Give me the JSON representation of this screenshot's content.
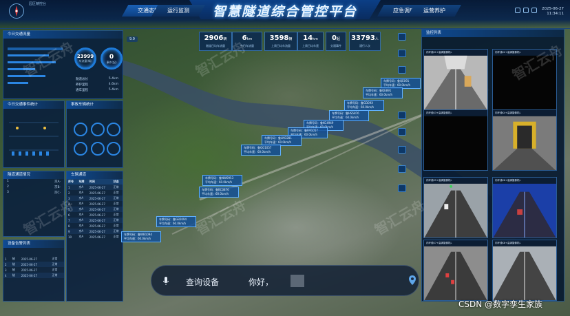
{
  "header": {
    "title": "智慧隧道综合管控平台",
    "brand_small": "园区精控台",
    "nav_left": [
      "交通态势",
      "运行监测"
    ],
    "nav_right": [
      "应急调度",
      "运营养护"
    ],
    "date": "2025-06-27",
    "time": "11:34:11"
  },
  "left_panels": {
    "traffic_stats": {
      "title": "今日交通流量",
      "gauge1_value": "23999",
      "gauge1_label": "车流量(辆)",
      "gauge2_value": "0",
      "gauge2_label": "事件(起)",
      "rows": [
        [
          "隧道总长",
          "5.4km"
        ],
        [
          "养护里程",
          "4.6km"
        ],
        [
          "通车里程",
          "5.4km"
        ]
      ]
    },
    "event_stats": {
      "title": "今日交通事件统计",
      "title2": "事故车辆统计"
    },
    "device_status": {
      "title": "隧道通道情况",
      "title2": "车辆通道",
      "rows": [
        [
          "1",
          "京A·"
        ],
        [
          "2",
          "京B·"
        ],
        [
          "3",
          "京C·"
        ]
      ]
    },
    "device_table": {
      "headers": [
        "序号",
        "车牌",
        "时间",
        "状态"
      ],
      "rows": [
        [
          "1",
          "京A",
          "2025-06-27",
          "正常"
        ],
        [
          "2",
          "京A",
          "2025-06-27",
          "正常"
        ],
        [
          "3",
          "京A",
          "2025-06-27",
          "正常"
        ],
        [
          "4",
          "京A",
          "2025-06-27",
          "正常"
        ],
        [
          "5",
          "京A",
          "2025-06-27",
          "正常"
        ],
        [
          "6",
          "京A",
          "2025-06-27",
          "正常"
        ],
        [
          "7",
          "京A",
          "2025-06-27",
          "正常"
        ],
        [
          "8",
          "京A",
          "2025-06-27",
          "正常"
        ],
        [
          "9",
          "京A",
          "2025-06-27",
          "正常"
        ],
        [
          "10",
          "京A",
          "2025-06-27",
          "正常"
        ]
      ]
    },
    "alarm_list": {
      "title": "设备告警列表",
      "rows": [
        [
          "1",
          "隧",
          "2025-06-27",
          "正常"
        ],
        [
          "2",
          "隧",
          "2025-06-27",
          "正常"
        ],
        [
          "3",
          "隧",
          "2025-06-27",
          "正常"
        ],
        [
          "4",
          "隧",
          "2025-06-27",
          "正常"
        ]
      ]
    }
  },
  "top_stats": [
    {
      "value": "2906",
      "unit": "辆",
      "caption": "隧道日均车流量"
    },
    {
      "value": "6",
      "unit": "km",
      "caption": "今日车流量"
    },
    {
      "value": "3598",
      "unit": "辆",
      "caption": "上周日均车流量"
    },
    {
      "value": "14",
      "unit": "km",
      "caption": "上周日均车速"
    },
    {
      "value": "0",
      "unit": "起",
      "caption": "交通事件"
    },
    {
      "value": "33793",
      "unit": "人",
      "caption": "通行人次"
    }
  ],
  "map_popups": [
    {
      "plate": "车牌号码：鲁QE091",
      "speed": "平均车速：60.0km/h"
    },
    {
      "plate": "车牌号码：鲁QE891",
      "speed": "平均车速：60.0km/h"
    },
    {
      "plate": "车牌号码：鲁GD09X",
      "speed": "平均车速：60.0km/h"
    },
    {
      "plate": "车牌号码：鲁HS5876",
      "speed": "平均车速：60.0km/h"
    },
    {
      "plate": "车牌号码：鲁KC4949",
      "speed": "平均车速：60.0km/h"
    },
    {
      "plate": "车牌号码：鲁FM1057",
      "speed": "平均车速：60.0km/h"
    },
    {
      "plate": "车牌号码：鲁LM3281",
      "speed": "平均车速：60.0km/h"
    },
    {
      "plate": "车牌号码：鲁QG1057",
      "speed": "平均车速：60.0km/h"
    },
    {
      "plate": "车牌号码：鲁NW0953",
      "speed": "平均车速：60.0km/h"
    },
    {
      "plate": "车牌号码：鲁BC0876",
      "speed": "平均车速：60.0km/h"
    },
    {
      "plate": "车牌号码：鲁GB2094",
      "speed": "平均车速：60.0km/h"
    },
    {
      "plate": "车牌号码：鲁WB1094",
      "speed": "平均车速：60.0km/h"
    }
  ],
  "cameras": {
    "title": "监控列表",
    "items": [
      "内环线K1+高清摄像机L",
      "内环线K2+高清摄像机L",
      "内环线K3+高清摄像机L",
      "内环线K4+高清摄像机L",
      "内环线K5+高清摄像机L",
      "内环线K6+高清摄像机L",
      "内环线K7+高清摄像机L",
      "内环线K8+高清摄像机L"
    ]
  },
  "search": {
    "label": "查询设备",
    "greeting": "你好，"
  },
  "watermarks": [
    "智汇云舟",
    "智汇云舟",
    "智汇云舟",
    "智汇云舟",
    "智汇云舟",
    "智汇云舟"
  ],
  "credit": "CSDN @数字孪生家族",
  "misc": {
    "speed_value": "9.9",
    "icons": [
      "mic-icon",
      "location-pin-icon",
      "compass-icon"
    ]
  }
}
